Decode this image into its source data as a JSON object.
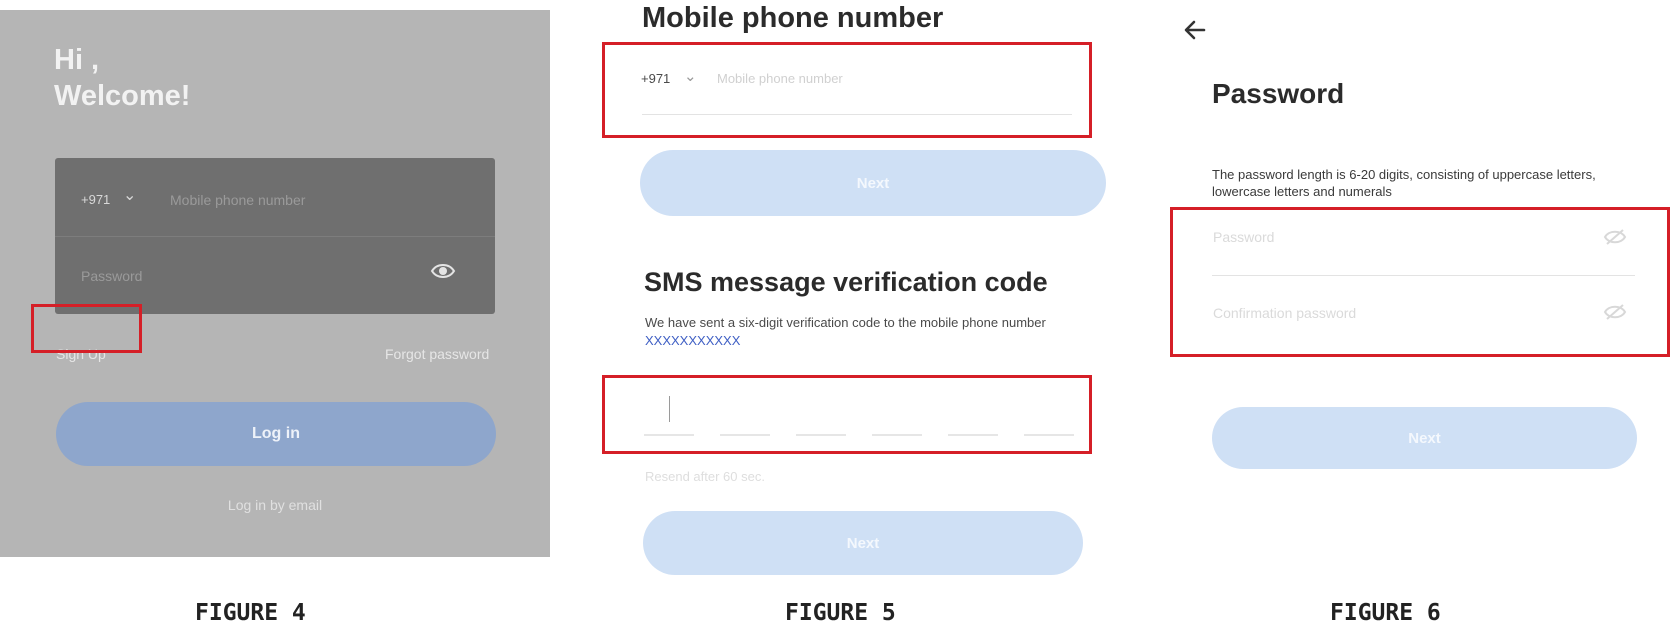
{
  "figure4": {
    "greeting_line1": "Hi ,",
    "greeting_line2": "Welcome!",
    "country_code": "+971",
    "phone_placeholder": "Mobile phone number",
    "password_placeholder": "Password",
    "sign_up": "Sign Up",
    "forgot_password": "Forgot password",
    "login_button": "Log in",
    "login_email": "Log in by email",
    "caption": "FIGURE 4"
  },
  "figure5": {
    "mobile_title": "Mobile phone number",
    "country_code": "+971",
    "phone_placeholder": "Mobile phone number",
    "next_button_1": "Next",
    "sms_title": "SMS message verification code",
    "sms_desc": "We have sent a six-digit verification code to the mobile phone number",
    "phone_mask": "XXXXXXXXXXX",
    "resend_hint": "Resend after 60 sec.",
    "next_button_2": "Next",
    "caption": "FIGURE 5"
  },
  "figure6": {
    "title": "Password",
    "desc": "The password length is 6-20 digits, consisting of uppercase letters, lowercase letters and numerals",
    "password_placeholder": "Password",
    "confirm_placeholder": "Confirmation password",
    "next_button": "Next",
    "caption": "FIGURE 6"
  },
  "colors": {
    "highlight_red": "#d51f27",
    "login_button_blue": "#8ea6cc",
    "next_button_blue": "#cfe0f5",
    "phone_link_blue": "#3f5fc4"
  }
}
